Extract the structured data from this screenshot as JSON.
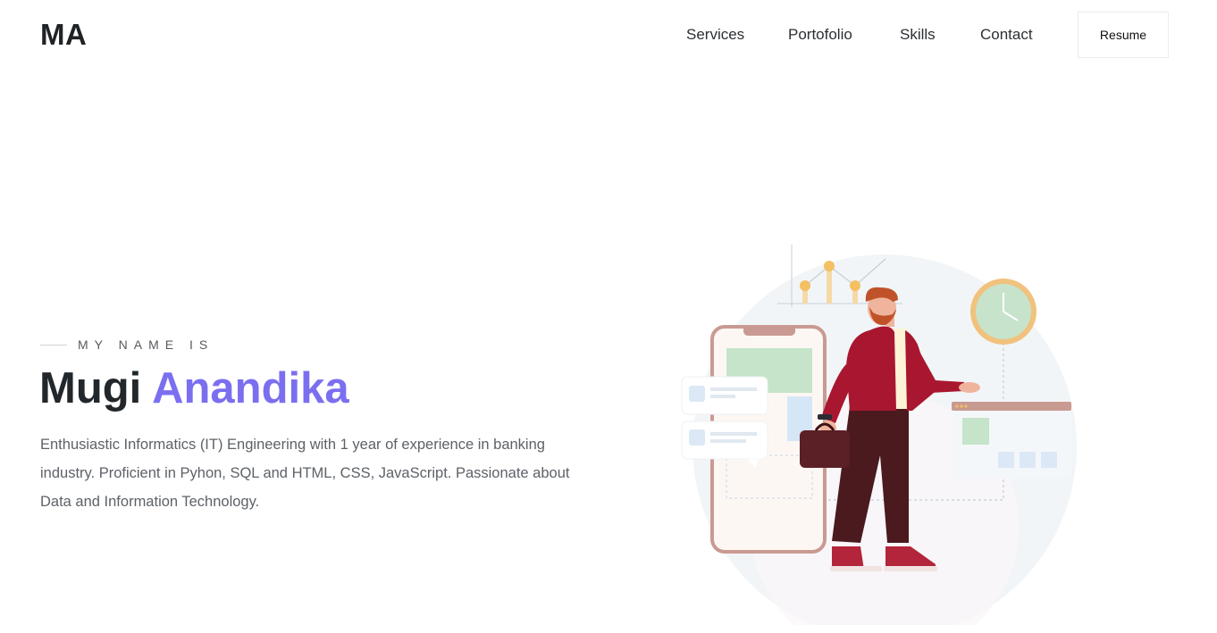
{
  "header": {
    "logo": "MA",
    "nav": [
      "Services",
      "Portofolio",
      "Skills",
      "Contact"
    ],
    "resume_label": "Resume"
  },
  "hero": {
    "intro": "MY NAME IS",
    "first_name": "Mugi",
    "last_name": "Anandika",
    "bio": "Enthusiastic Informatics (IT) Engineering with 1 year of experience in banking industry. Proficient in Pyhon, SQL and HTML, CSS, JavaScript. Passionate about Data and Information Technology."
  },
  "colors": {
    "accent": "#7b6ff0",
    "text_dark": "#22272b",
    "text_muted": "#5d6268"
  }
}
